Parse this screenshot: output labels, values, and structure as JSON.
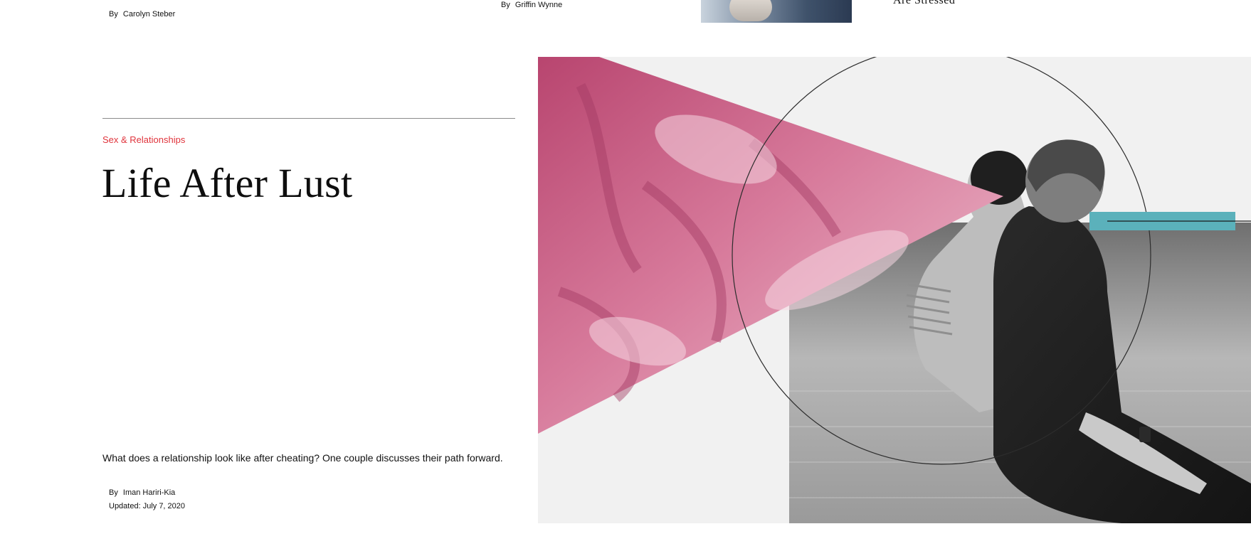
{
  "top_strip": {
    "byline_1": {
      "by": "By",
      "author": "Carolyn Steber"
    },
    "byline_2": {
      "by": "By",
      "author": "Griffin Wynne"
    },
    "cut_text": "Are Stressed"
  },
  "article": {
    "category": "Sex & Relationships",
    "headline": "Life After Lust",
    "dek": "What does a relationship look like after cheating? One couple discusses their path forward.",
    "byline": {
      "by": "By",
      "author": "Iman Hariri-Kia"
    },
    "updated": "Updated: July 7, 2020"
  },
  "colors": {
    "accent_category": "#e0343c",
    "pink_overlay": "#c7587f",
    "teal_bar": "#5bb1bb",
    "hero_background": "#f1f1f1"
  }
}
